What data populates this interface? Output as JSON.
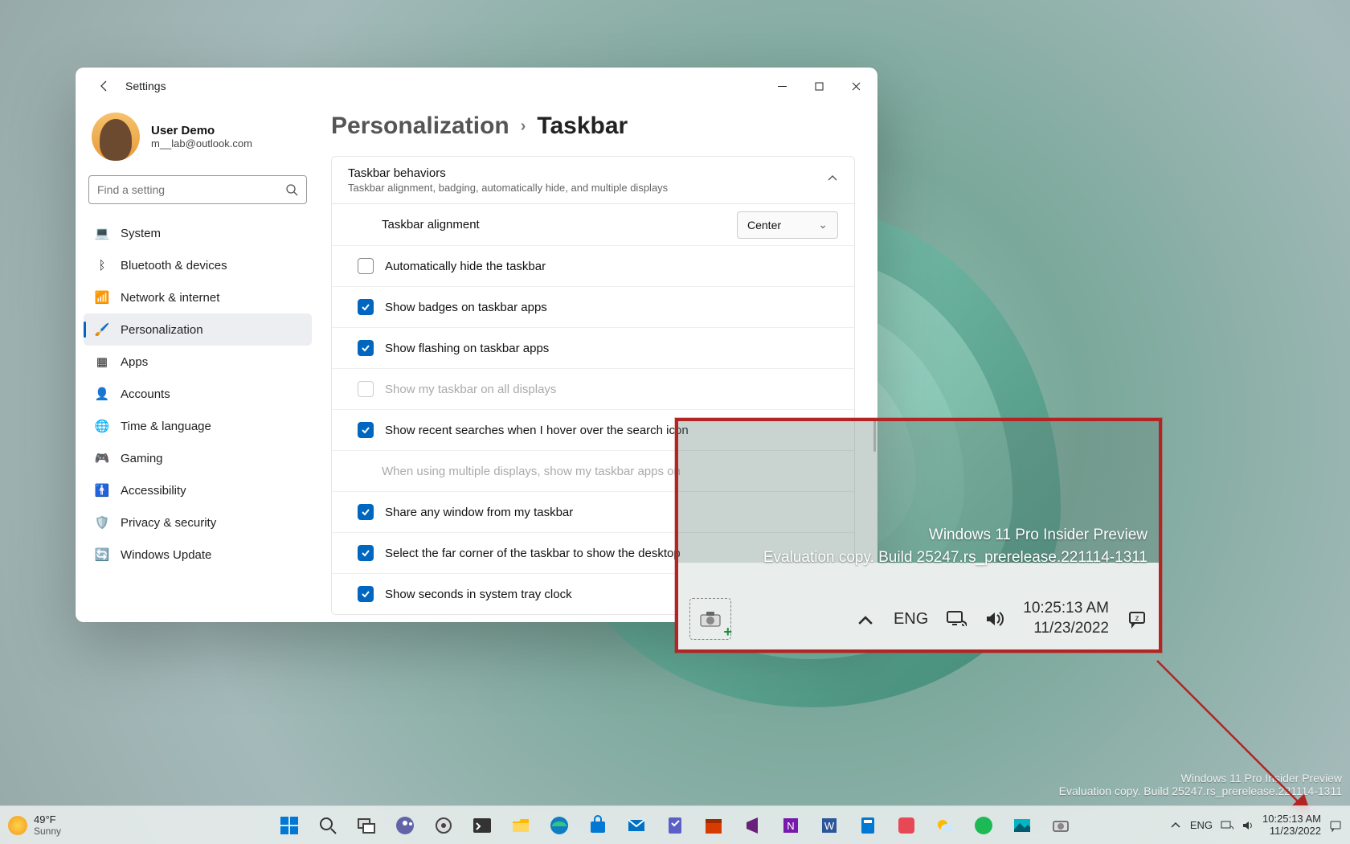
{
  "window": {
    "app_title": "Settings",
    "user": {
      "name": "User Demo",
      "email": "m__lab@outlook.com"
    },
    "search_placeholder": "Find a setting",
    "nav": [
      {
        "id": "system",
        "label": "System",
        "icon": "💻"
      },
      {
        "id": "bluetooth",
        "label": "Bluetooth & devices",
        "icon": "ᛒ"
      },
      {
        "id": "network",
        "label": "Network & internet",
        "icon": "📶"
      },
      {
        "id": "personalization",
        "label": "Personalization",
        "icon": "🖌️",
        "active": true
      },
      {
        "id": "apps",
        "label": "Apps",
        "icon": "▦"
      },
      {
        "id": "accounts",
        "label": "Accounts",
        "icon": "👤"
      },
      {
        "id": "time",
        "label": "Time & language",
        "icon": "🌐"
      },
      {
        "id": "gaming",
        "label": "Gaming",
        "icon": "🎮"
      },
      {
        "id": "accessibility",
        "label": "Accessibility",
        "icon": "🚹"
      },
      {
        "id": "privacy",
        "label": "Privacy & security",
        "icon": "🛡️"
      },
      {
        "id": "update",
        "label": "Windows Update",
        "icon": "🔄"
      }
    ],
    "breadcrumb": {
      "parent": "Personalization",
      "current": "Taskbar"
    },
    "section": {
      "title": "Taskbar behaviors",
      "subtitle": "Taskbar alignment, badging, automatically hide, and multiple displays"
    },
    "rows": {
      "alignment_label": "Taskbar alignment",
      "alignment_value": "Center",
      "autohide": "Automatically hide the taskbar",
      "badges": "Show badges on taskbar apps",
      "flashing": "Show flashing on taskbar apps",
      "all_displays": "Show my taskbar on all displays",
      "recent": "Show recent searches when I hover over the search icon",
      "multi_heading": "When using multiple displays, show my taskbar apps on",
      "share": "Share any window from my taskbar",
      "corner": "Select the far corner of the taskbar to show the desktop",
      "seconds": "Show seconds in system tray clock"
    }
  },
  "watermark": {
    "line1": "Windows 11 Pro Insider Preview",
    "line2": "Evaluation copy. Build 25247.rs_prerelease.221114-1311"
  },
  "taskbar": {
    "weather_temp": "49°F",
    "weather_desc": "Sunny",
    "lang": "ENG",
    "time": "10:25:13 AM",
    "date": "11/23/2022"
  },
  "callout": {
    "lang": "ENG",
    "time": "10:25:13 AM",
    "date": "11/23/2022"
  }
}
